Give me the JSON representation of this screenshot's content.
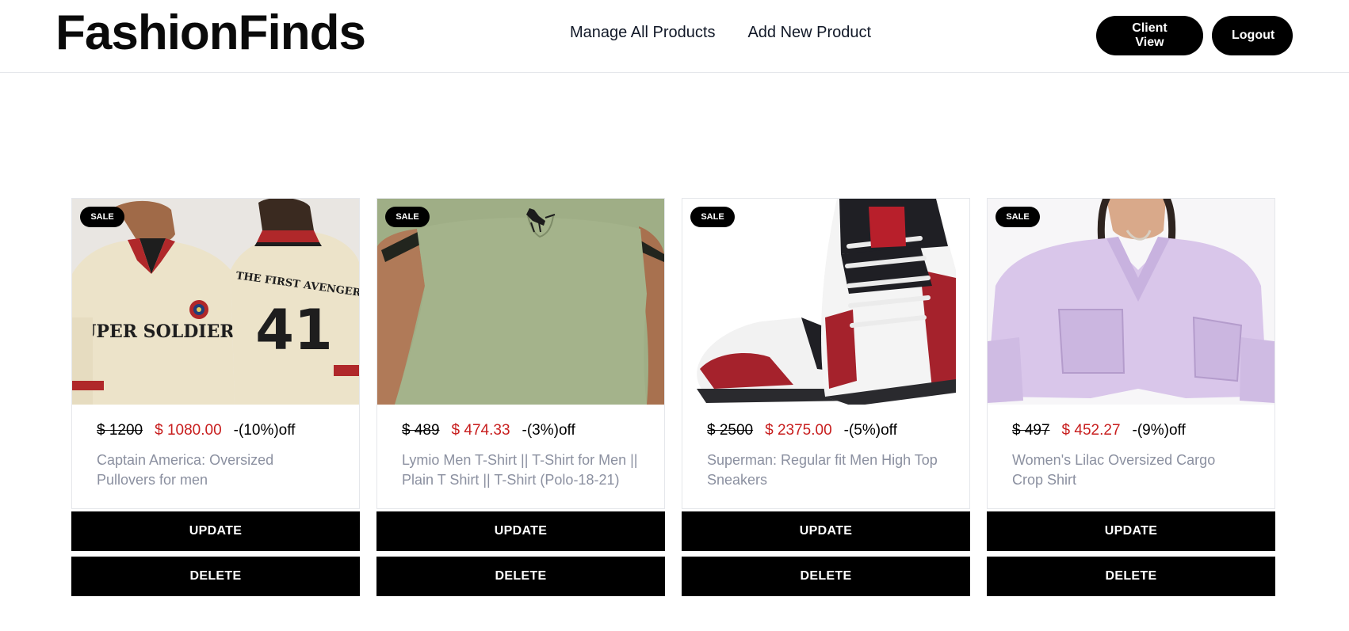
{
  "brand": {
    "name": "FashionFinds"
  },
  "nav": {
    "links": [
      "Manage All Products",
      "Add New Product"
    ],
    "client_view": "Client View",
    "logout": "Logout"
  },
  "colors": {
    "primary": "#000000",
    "sale_price": "#c81e1e",
    "muted_text": "#8b90a0",
    "border": "#e5e7eb"
  },
  "products": [
    {
      "badge": "SALE",
      "original_price": "$ 1200",
      "sale_price": "$ 1080.00",
      "discount": "-(10%)off",
      "title": "Captain America: Oversized Pullovers for men",
      "image_icon": "pullover-image",
      "update_label": "UPDATE",
      "delete_label": "DELETE",
      "image_text": {
        "front": "SUPER SOLDIER",
        "back": "THE FIRST AVENGER",
        "number": "41"
      }
    },
    {
      "badge": "SALE",
      "original_price": "$ 489",
      "sale_price": "$ 474.33",
      "discount": "-(3%)off",
      "title": "Lymio Men T-Shirt || T-Shirt for Men || Plain T Shirt || T-Shirt (Polo-18-21)",
      "image_icon": "polo-shirt-image",
      "update_label": "UPDATE",
      "delete_label": "DELETE"
    },
    {
      "badge": "SALE",
      "original_price": "$ 2500",
      "sale_price": "$ 2375.00",
      "discount": "-(5%)off",
      "title": "Superman: Regular fit Men High Top Sneakers",
      "image_icon": "sneakers-image",
      "update_label": "UPDATE",
      "delete_label": "DELETE"
    },
    {
      "badge": "SALE",
      "original_price": "$ 497",
      "sale_price": "$ 452.27",
      "discount": "-(9%)off",
      "title": "Women's Lilac Oversized Cargo Crop Shirt",
      "image_icon": "crop-shirt-image",
      "update_label": "UPDATE",
      "delete_label": "DELETE"
    }
  ]
}
